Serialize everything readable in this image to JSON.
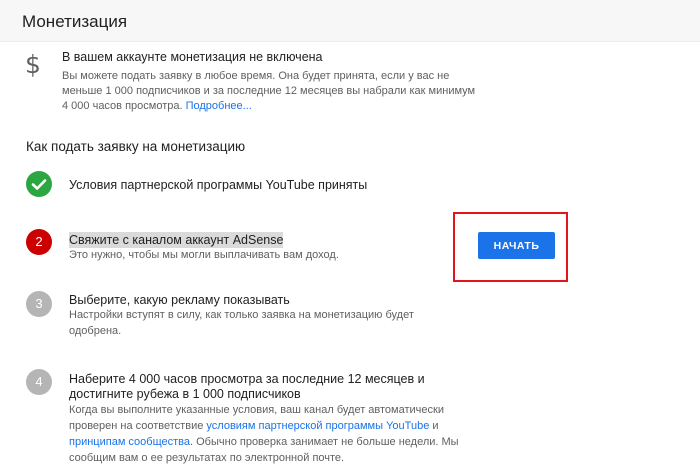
{
  "header": {
    "title": "Монетизация"
  },
  "status": {
    "icon": "dollar-icon",
    "title": "В вашем аккаунте монетизация не включена",
    "desc": "Вы можете подать заявку в любое время. Она будет принята, если у вас не меньше 1 000 подписчиков и за последние 12 месяцев вы набрали как минимум 4 000 часов просмотра.",
    "more_link": "Подробнее..."
  },
  "section": {
    "title": "Как подать заявку на монетизацию"
  },
  "steps": [
    {
      "marker": "✓",
      "title": "Условия партнерской программы YouTube приняты"
    },
    {
      "marker": "2",
      "title": "Свяжите с каналом аккаунт AdSense",
      "desc": "Это нужно, чтобы мы могли выплачивать вам доход."
    },
    {
      "marker": "3",
      "title": "Выберите, какую рекламу показывать",
      "desc_line1": "Настройки вступят в силу, как только заявка на монетизацию будет",
      "desc_line2": "одобрена."
    },
    {
      "marker": "4",
      "title_line1": "Наберите 4 000 часов просмотра за последние 12 месяцев и",
      "title_line2": "достигните рубежа в 1 000 подписчиков",
      "desc_line1": "Когда вы выполните указанные условия, ваш канал будет автоматически",
      "desc_line2_a": "проверен на соответствие",
      "desc_line2_link": "условиям партнерской программы YouTube",
      "desc_line2_b": "и",
      "desc_line3_link": "принципам сообщества",
      "desc_line3_b": ". Обычно проверка занимает не больше недели. Мы",
      "desc_line4": "сообщим вам о ее результатах по электронной почте."
    }
  ],
  "start_button": {
    "label": "НАЧАТЬ"
  },
  "colors": {
    "accent": "#1a73e8",
    "success": "#2ba640",
    "active_step": "#cc0000",
    "disabled_step": "#b5b5b5",
    "highlight_frame": "#e5141b"
  }
}
